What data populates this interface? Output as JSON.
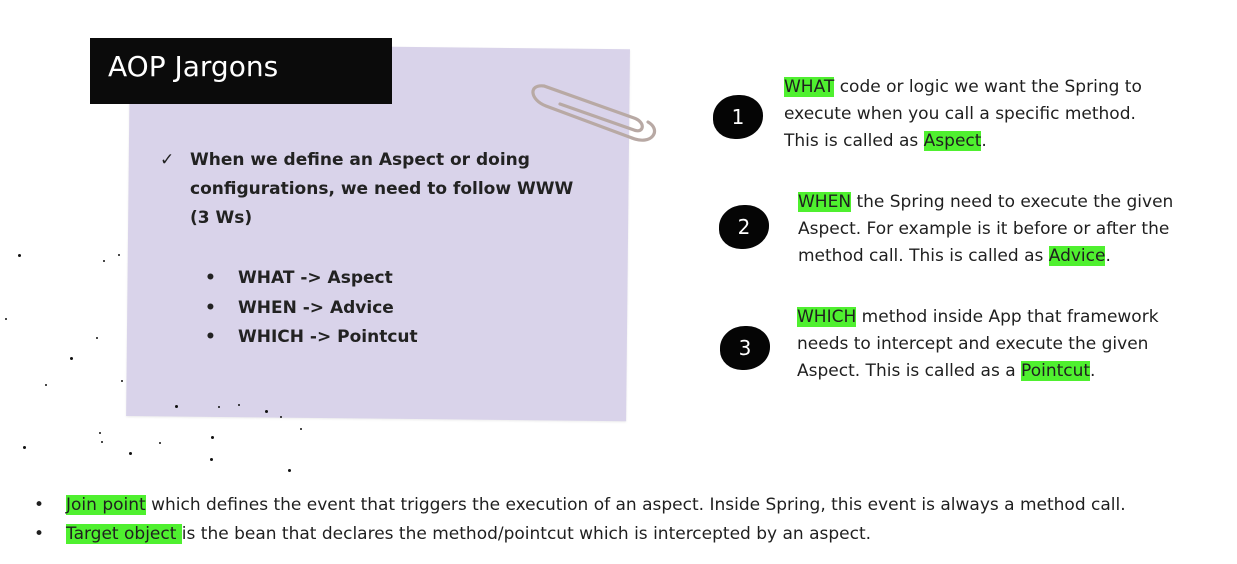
{
  "title": "AOP Jargons",
  "check_text": "When we define an Aspect or doing configurations, we need to follow WWW (3 Ws)",
  "sub_items": [
    "WHAT -> Aspect",
    "WHEN -> Advice",
    "WHICH -> Pointcut"
  ],
  "steps": [
    {
      "number": "1",
      "keyword": "WHAT",
      "text_before": " code or logic we want the Spring to execute when you call a specific method. This is called as ",
      "term": "Aspect",
      "text_after": "."
    },
    {
      "number": "2",
      "keyword": "WHEN",
      "text_before": " the Spring need to execute the given Aspect. For example is it before or after the method call. This is called as ",
      "term": "Advice",
      "text_after": "."
    },
    {
      "number": "3",
      "keyword": "WHICH",
      "text_before": " method inside App that framework needs to intercept and execute the given Aspect. This is called as a ",
      "term": "Pointcut",
      "text_after": "."
    }
  ],
  "bottom_notes": [
    {
      "term": "Join point",
      "text": " which defines the event that triggers the execution of an aspect. Inside Spring, this event is always a method call."
    },
    {
      "term": "Target object ",
      "text": "is the bean that declares the method/pointcut which is intercepted by an aspect."
    }
  ],
  "colors": {
    "highlight": "#4ff02f",
    "card": "#d9d3ea",
    "title_bg": "#0b0b0b"
  },
  "icons": {
    "check": "checkmark-icon",
    "clip": "paperclip-icon"
  }
}
